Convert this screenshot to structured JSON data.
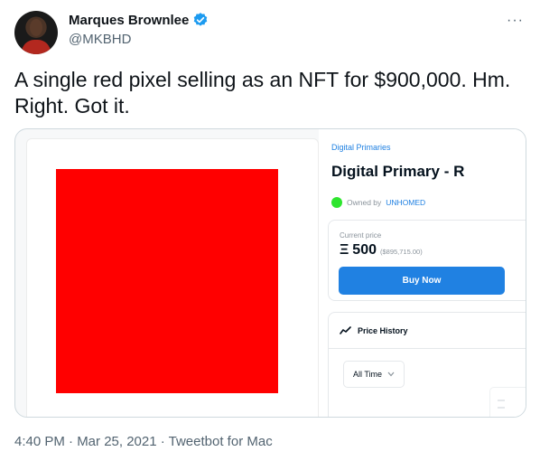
{
  "author": {
    "name": "Marques Brownlee",
    "handle": "@MKBHD"
  },
  "tweet": {
    "text_line1": "A single red pixel selling as an NFT for $900,000. Hm.",
    "text_line2": "Right. Got it."
  },
  "nft": {
    "collection": "Digital Primaries",
    "title": "Digital Primary - R",
    "owned_by_label": "Owned by",
    "owner": "UNHOMED",
    "current_price_label": "Current price",
    "eth_symbol": "Ξ",
    "price": "500",
    "usd_price": "($895,715.00)",
    "buy_label": "Buy Now",
    "history_label": "Price History",
    "time_filter": "All Time"
  },
  "footer": {
    "meta": "4:40 PM · Mar 25, 2021 · Tweetbot for Mac"
  },
  "colors": {
    "pixel": "#ff0000",
    "button": "#2081e2",
    "owner_status": "#2ee52e",
    "verified": "#1d9bf0"
  },
  "icons": {
    "verified": "verified-badge-icon",
    "more": "more-options-icon",
    "trend": "trend-line-icon",
    "chevron": "chevron-down-icon"
  }
}
